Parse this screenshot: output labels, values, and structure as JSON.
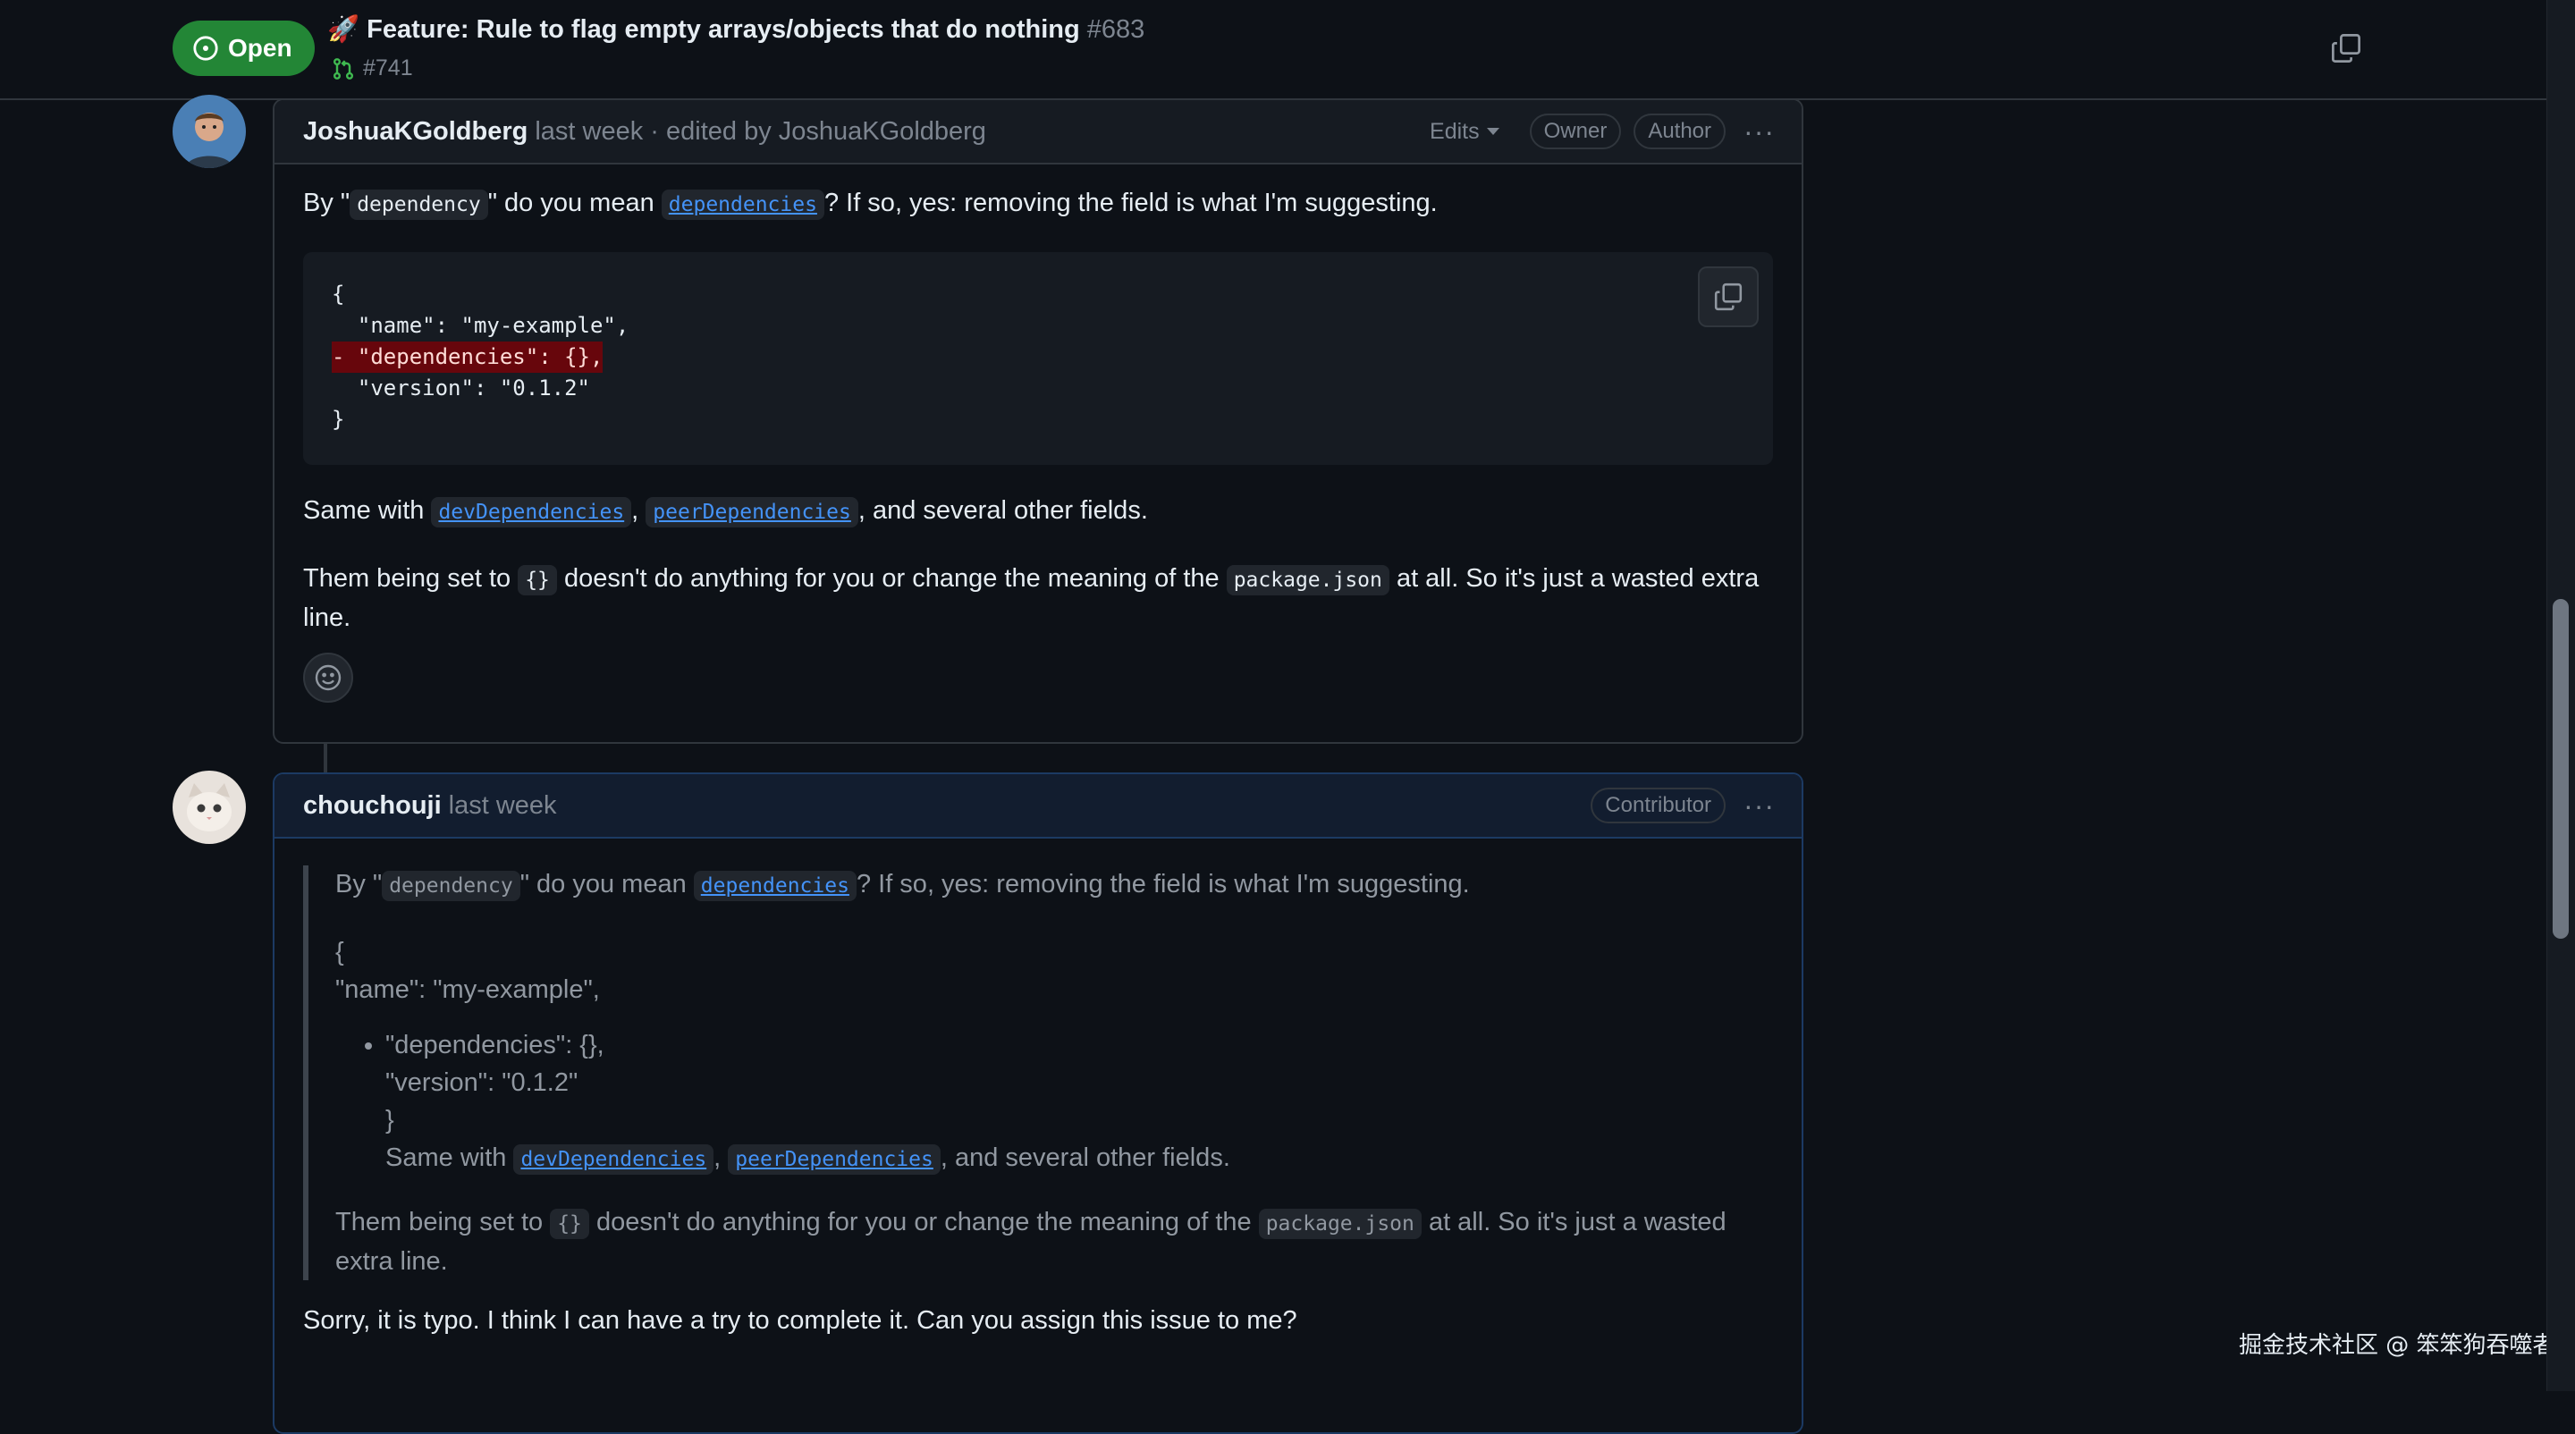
{
  "header": {
    "status": "Open",
    "title_emoji": "🚀",
    "title": "Feature: Rule to flag empty arrays/objects that do nothing",
    "number": "#683",
    "linked_pr": "#741"
  },
  "comment1": {
    "author": "JoshuaKGoldberg",
    "meta": "last week · edited by JoshuaKGoldberg",
    "edits_label": "Edits",
    "roles": [
      "Owner",
      "Author"
    ],
    "p1": {
      "before": "By \"",
      "code1": "dependency",
      "mid": "\" do you mean",
      "code2": "dependencies",
      "after": "? If so, yes: removing the field is what I'm suggesting."
    },
    "code_lines": [
      "{",
      "  \"name\": \"my-example\",",
      "- \"dependencies\": {},",
      "  \"version\": \"0.1.2\"",
      "}"
    ],
    "p2": {
      "before": "Same with",
      "code1": "devDependencies",
      "comma": ",",
      "code2": "peerDependencies",
      "after": ", and several other fields."
    },
    "p3": {
      "before": "Them being set to",
      "code1": "{}",
      "mid": "doesn't do anything for you or change the meaning of the",
      "code2": "package.json",
      "after": "at all. So it's just a wasted extra line."
    }
  },
  "comment2": {
    "author": "chouchouji",
    "meta": "last week",
    "role": "Contributor",
    "quote": {
      "p1_before": "By \"",
      "p1_code1": "dependency",
      "p1_mid": "\" do you mean",
      "p1_code2": "dependencies",
      "p1_after": "? If so, yes: removing the field is what I'm suggesting.",
      "line_open": "{",
      "line_name": "\"name\": \"my-example\",",
      "li_deps": "\"dependencies\": {},",
      "li_version": "\"version\": \"0.1.2\"",
      "li_close": "}",
      "li_same_before": "Same with",
      "li_same_code1": "devDependencies",
      "li_same_comma": ",",
      "li_same_code2": "peerDependencies",
      "li_same_after": ", and several other fields.",
      "p3_before": "Them being set to",
      "p3_code1": "{}",
      "p3_mid": "doesn't do anything for you or change the meaning of the",
      "p3_code2": "package.json",
      "p3_after": "at all. So it's just a wasted extra line."
    },
    "reply": "Sorry, it is typo. I think I can have a try to complete it. Can you assign this issue to me?"
  },
  "watermark": "掘金技术社区 @ 笨笨狗吞噬者"
}
